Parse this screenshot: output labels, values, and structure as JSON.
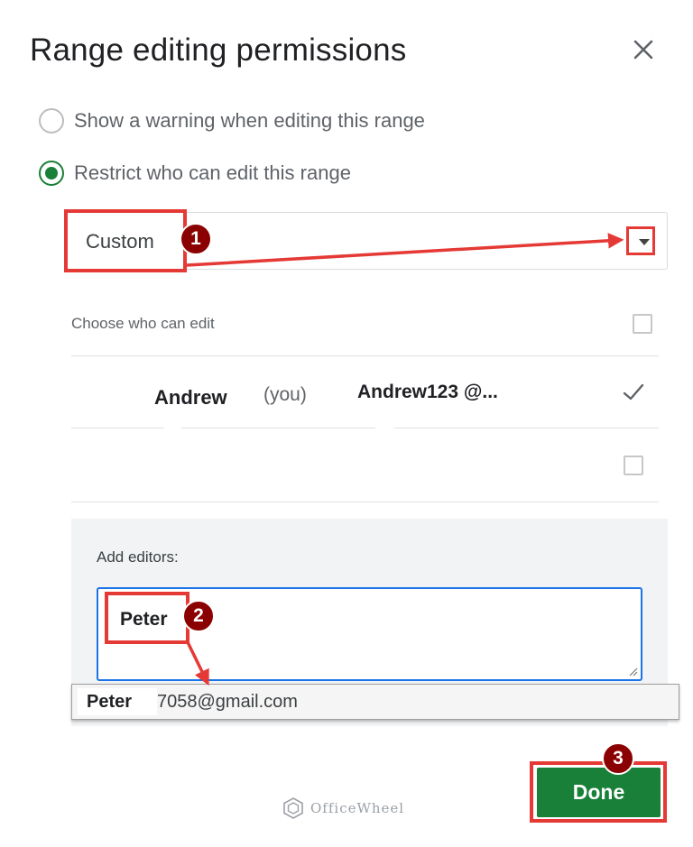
{
  "dialog": {
    "title": "Range editing permissions"
  },
  "options": {
    "warning_label": "Show a warning when editing this range",
    "restrict_label": "Restrict who can edit this range",
    "selected": "restrict"
  },
  "select": {
    "value": "Custom"
  },
  "editors_list": {
    "header": "Choose who can edit",
    "users": [
      {
        "name": "Andrew",
        "tag": "(you)",
        "email": "Andrew123 @...",
        "checked": true
      }
    ]
  },
  "add_editors": {
    "label": "Add editors:",
    "value": "Peter"
  },
  "suggestion": {
    "name": "Peter",
    "email": "7058@gmail.com"
  },
  "actions": {
    "done_label": "Done"
  },
  "annotations": {
    "step1": "1",
    "step2": "2",
    "step3": "3"
  },
  "watermark": {
    "text": "OfficeWheel"
  },
  "colors": {
    "accent_green": "#188038",
    "focus_blue": "#1a73e8",
    "annotation_red": "#e53935",
    "step_badge": "#8b0000"
  }
}
